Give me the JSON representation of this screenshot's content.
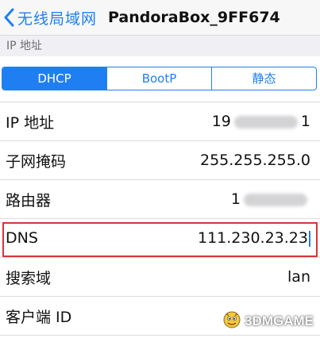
{
  "navbar": {
    "back_label": "无线局域网",
    "title": "PandoraBox_9FF674"
  },
  "section": {
    "header": "IP 地址"
  },
  "segment": {
    "items": [
      "DHCP",
      "BootP",
      "静态"
    ],
    "active": "DHCP"
  },
  "rows": [
    {
      "label": "IP 地址",
      "value_prefix": "19",
      "value_suffix": "1",
      "masked": true
    },
    {
      "label": "子网掩码",
      "value": "255.255.255.0"
    },
    {
      "label": "路由器",
      "value_prefix": "1",
      "value_suffix": "",
      "masked": true
    },
    {
      "label": "DNS",
      "value": "111.230.23.23"
    },
    {
      "label": "搜索域",
      "value": "lan"
    },
    {
      "label": "客户端 ID",
      "value": ""
    }
  ],
  "colors": {
    "accent": "#1f7ff2",
    "highlight": "#d8343a"
  },
  "watermark": {
    "text": "3DMGAME"
  }
}
